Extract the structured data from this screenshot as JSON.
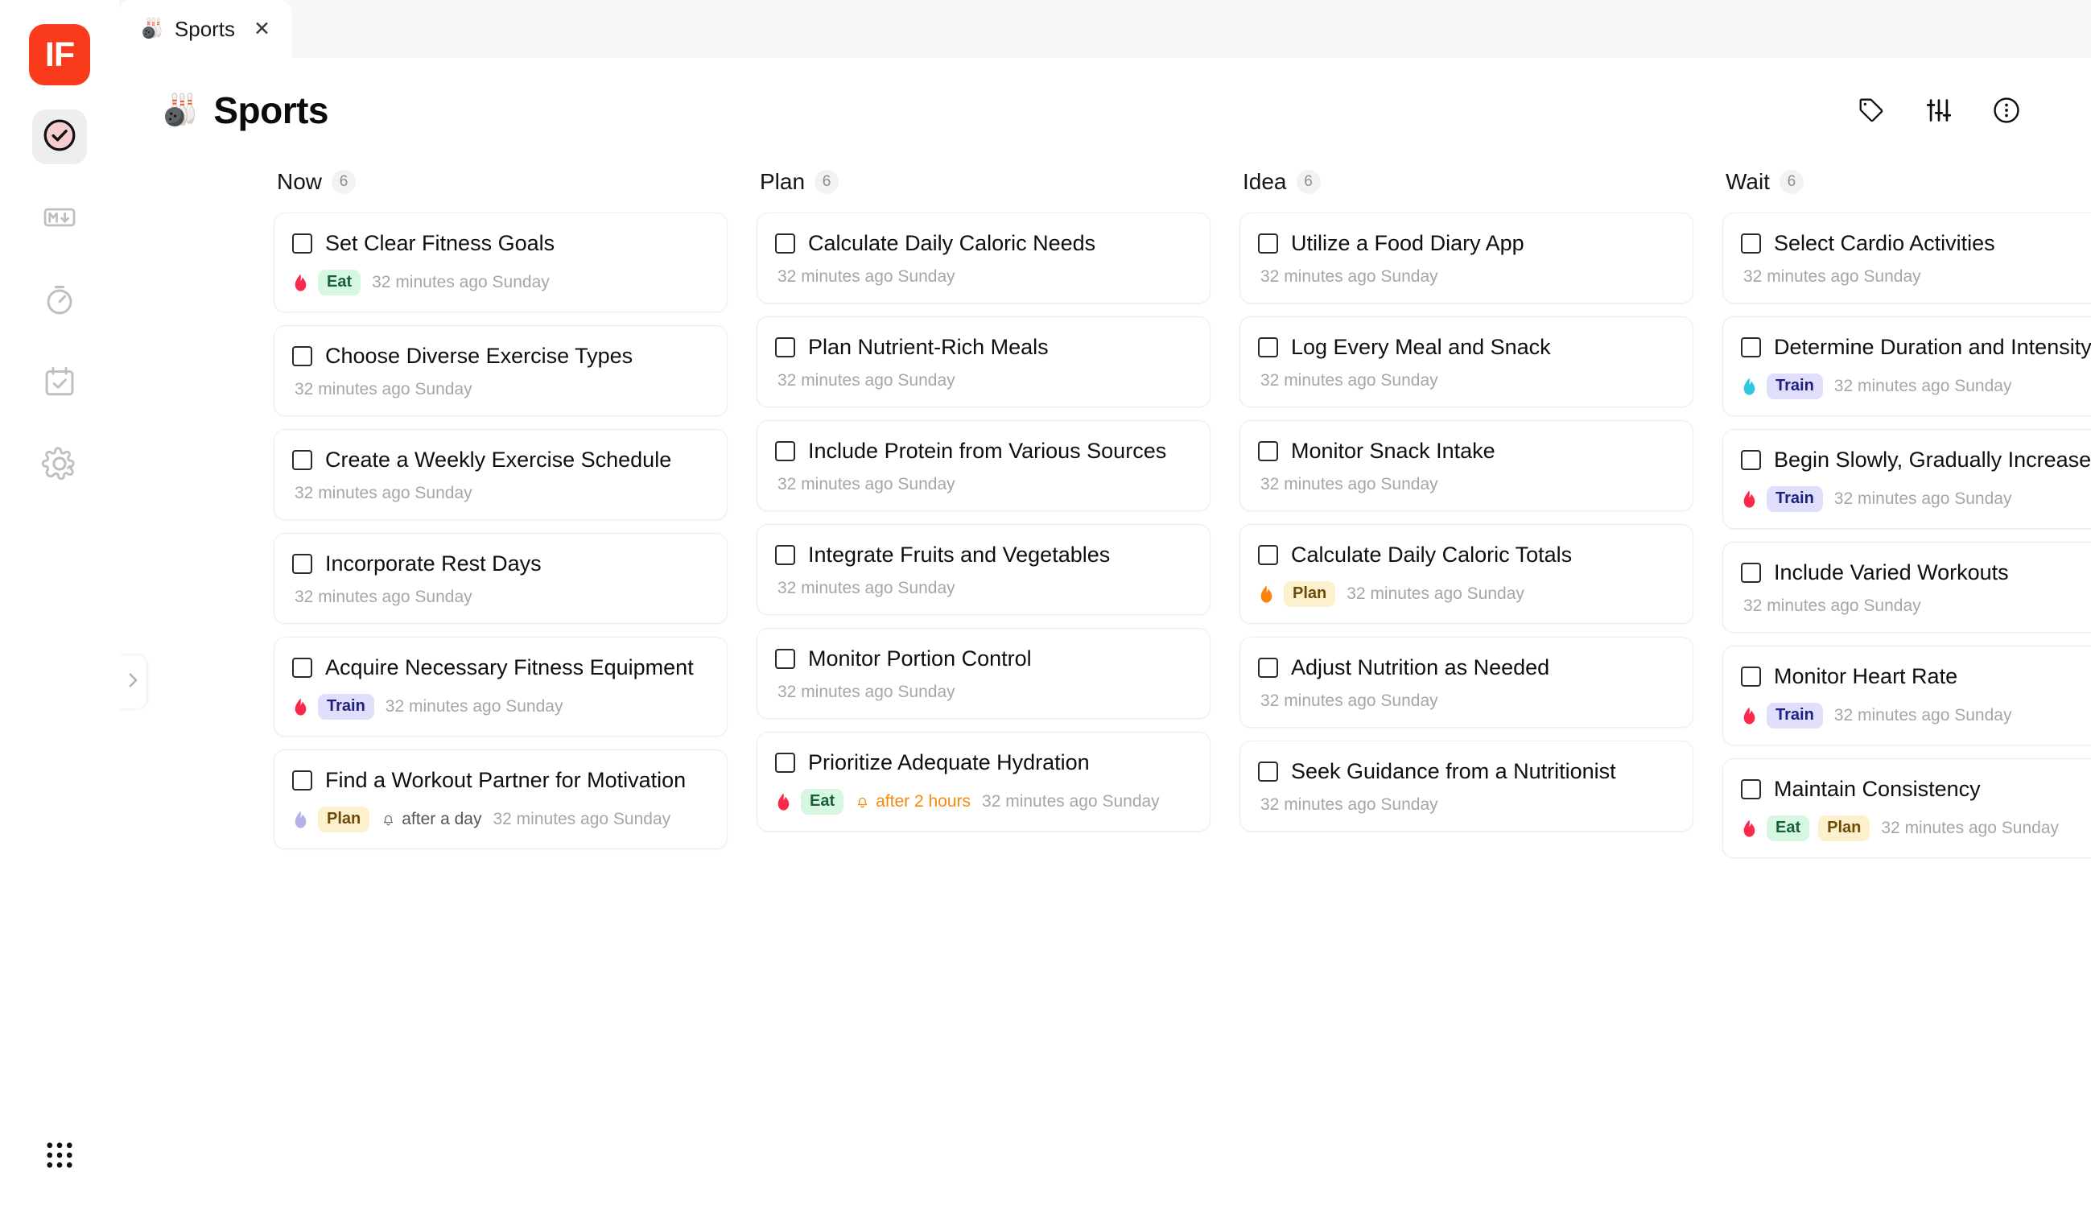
{
  "app": {
    "logo_text": "IF",
    "logo_color": "#f93a1b"
  },
  "sidebar": {
    "items": [
      {
        "name": "tasks",
        "icon": "check-circle-icon",
        "active": true
      },
      {
        "name": "markdown",
        "icon": "markdown-icon",
        "active": false
      },
      {
        "name": "timer",
        "icon": "timer-icon",
        "active": false
      },
      {
        "name": "calendar",
        "icon": "calendar-check-icon",
        "active": false
      },
      {
        "name": "settings",
        "icon": "gear-icon",
        "active": false
      }
    ],
    "app_grid_icon": "grid-dots-icon"
  },
  "tab": {
    "emoji": "🎳",
    "label": "Sports",
    "close": "✕"
  },
  "header": {
    "emoji": "🎳",
    "title": "Sports",
    "actions": [
      {
        "name": "tag-icon",
        "label": "Tags"
      },
      {
        "name": "filter-sliders-icon",
        "label": "Filter"
      },
      {
        "name": "more-circle-icon",
        "label": "More"
      }
    ]
  },
  "expand_handle": {
    "icon": "chevron-right-icon"
  },
  "board": {
    "columns": [
      {
        "title": "Now",
        "count": "6",
        "cards": [
          {
            "title": "Set Clear Fitness Goals",
            "priority_color": "#fa2a4c",
            "tags": [
              {
                "label": "Eat",
                "style": "eat"
              }
            ],
            "reminder": null,
            "timestamp": "32 minutes ago Sunday"
          },
          {
            "title": "Choose Diverse Exercise Types",
            "priority_color": null,
            "tags": [],
            "reminder": null,
            "timestamp": "32 minutes ago Sunday"
          },
          {
            "title": "Create a Weekly Exercise Schedule",
            "priority_color": null,
            "tags": [],
            "reminder": null,
            "timestamp": "32 minutes ago Sunday"
          },
          {
            "title": "Incorporate Rest Days",
            "priority_color": null,
            "tags": [],
            "reminder": null,
            "timestamp": "32 minutes ago Sunday"
          },
          {
            "title": "Acquire Necessary Fitness Equipment",
            "priority_color": "#fa2a4c",
            "tags": [
              {
                "label": "Train",
                "style": "train"
              }
            ],
            "reminder": null,
            "timestamp": "32 minutes ago Sunday"
          },
          {
            "title": "Find a Workout Partner for Motivation",
            "priority_color": "#b3b3e6",
            "tags": [
              {
                "label": "Plan",
                "style": "plan"
              }
            ],
            "reminder": {
              "text": "after a day",
              "tone": "gray"
            },
            "timestamp": "32 minutes ago Sunday"
          }
        ]
      },
      {
        "title": "Plan",
        "count": "6",
        "cards": [
          {
            "title": "Calculate Daily Caloric Needs",
            "priority_color": null,
            "tags": [],
            "reminder": null,
            "timestamp": "32 minutes ago Sunday"
          },
          {
            "title": "Plan Nutrient-Rich Meals",
            "priority_color": null,
            "tags": [],
            "reminder": null,
            "timestamp": "32 minutes ago Sunday"
          },
          {
            "title": "Include Protein from Various Sources",
            "priority_color": null,
            "tags": [],
            "reminder": null,
            "timestamp": "32 minutes ago Sunday"
          },
          {
            "title": "Integrate Fruits and Vegetables",
            "priority_color": null,
            "tags": [],
            "reminder": null,
            "timestamp": "32 minutes ago Sunday"
          },
          {
            "title": "Monitor Portion Control",
            "priority_color": null,
            "tags": [],
            "reminder": null,
            "timestamp": "32 minutes ago Sunday"
          },
          {
            "title": "Prioritize Adequate Hydration",
            "priority_color": "#fa2a4c",
            "tags": [
              {
                "label": "Eat",
                "style": "eat"
              }
            ],
            "reminder": {
              "text": "after 2 hours",
              "tone": "orange"
            },
            "timestamp": "32 minutes ago Sunday"
          }
        ]
      },
      {
        "title": "Idea",
        "count": "6",
        "cards": [
          {
            "title": "Utilize a Food Diary App",
            "priority_color": null,
            "tags": [],
            "reminder": null,
            "timestamp": "32 minutes ago Sunday"
          },
          {
            "title": "Log Every Meal and Snack",
            "priority_color": null,
            "tags": [],
            "reminder": null,
            "timestamp": "32 minutes ago Sunday"
          },
          {
            "title": "Monitor Snack Intake",
            "priority_color": null,
            "tags": [],
            "reminder": null,
            "timestamp": "32 minutes ago Sunday"
          },
          {
            "title": "Calculate Daily Caloric Totals",
            "priority_color": "#f98207",
            "tags": [
              {
                "label": "Plan",
                "style": "plan"
              }
            ],
            "reminder": null,
            "timestamp": "32 minutes ago Sunday"
          },
          {
            "title": "Adjust Nutrition as Needed",
            "priority_color": null,
            "tags": [],
            "reminder": null,
            "timestamp": "32 minutes ago Sunday"
          },
          {
            "title": "Seek Guidance from a Nutritionist",
            "priority_color": null,
            "tags": [],
            "reminder": null,
            "timestamp": "32 minutes ago Sunday"
          }
        ]
      },
      {
        "title": "Wait",
        "count": "6",
        "cards": [
          {
            "title": "Select Cardio Activities",
            "priority_color": null,
            "tags": [],
            "reminder": null,
            "timestamp": "32 minutes ago Sunday"
          },
          {
            "title": "Determine Duration and Intensity",
            "priority_color": "#2ec8de",
            "tags": [
              {
                "label": "Train",
                "style": "train"
              }
            ],
            "reminder": null,
            "timestamp": "32 minutes ago Sunday"
          },
          {
            "title": "Begin Slowly, Gradually Increase",
            "priority_color": "#fa2a4c",
            "tags": [
              {
                "label": "Train",
                "style": "train"
              }
            ],
            "reminder": null,
            "timestamp": "32 minutes ago Sunday"
          },
          {
            "title": "Include Varied Workouts",
            "priority_color": null,
            "tags": [],
            "reminder": null,
            "timestamp": "32 minutes ago Sunday"
          },
          {
            "title": "Monitor Heart Rate",
            "priority_color": "#fa2a4c",
            "tags": [
              {
                "label": "Train",
                "style": "train"
              }
            ],
            "reminder": null,
            "timestamp": "32 minutes ago Sunday"
          },
          {
            "title": "Maintain Consistency",
            "priority_color": "#fa2a4c",
            "tags": [
              {
                "label": "Eat",
                "style": "eat"
              },
              {
                "label": "Plan",
                "style": "plan"
              }
            ],
            "reminder": null,
            "timestamp": "32 minutes ago Sunday"
          }
        ]
      }
    ]
  }
}
